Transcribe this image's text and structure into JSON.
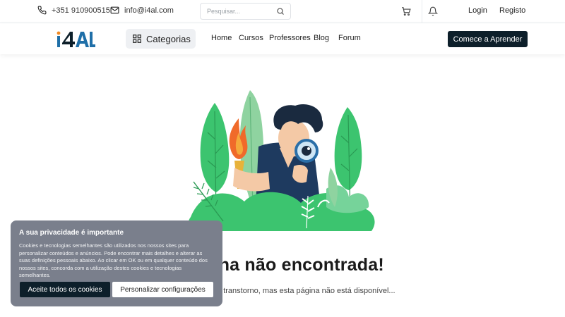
{
  "topbar": {
    "phone": "+351 910900515",
    "email": "info@i4al.com",
    "search_placeholder": "Pesquisar...",
    "login": "Login",
    "register": "Registo",
    "icons": [
      "phone-icon",
      "mail-icon",
      "search-icon",
      "cart-icon",
      "bell-icon"
    ]
  },
  "navbar": {
    "logo_text": "i4AL",
    "categories_label": "Categorias",
    "links": [
      "Home",
      "Cursos",
      "Professores",
      "Blog",
      "Forum"
    ],
    "cta_label": "Comece a Aprender"
  },
  "main": {
    "headline": "Página não encontrada!",
    "subtitle": "Lamentamos o transtorno, mas esta página não está disponível..."
  },
  "cookie": {
    "title": "A sua privacidade é importante",
    "body": "Cookies e tecnologias semelhantes são utilizados nos nossos sites para personalizar conteúdos e anúncios. Pode encontrar mais detalhes e alterar as suas definições pessoais abaixo. Ao clicar em OK ou em qualquer conteúdo dos nossos sites, concorda com a utilização destes cookies e tecnologias semelhantes.",
    "accept_label": "Aceite todos os cookies",
    "customize_label": "Personalizar configurações"
  },
  "colors": {
    "brand_dark": "#0d1f2a",
    "logo_blue": "#1f6fa8",
    "logo_orange": "#f08a24",
    "illustration_green": "#3cc46f",
    "cookie_bg": "#7a7f8c"
  }
}
